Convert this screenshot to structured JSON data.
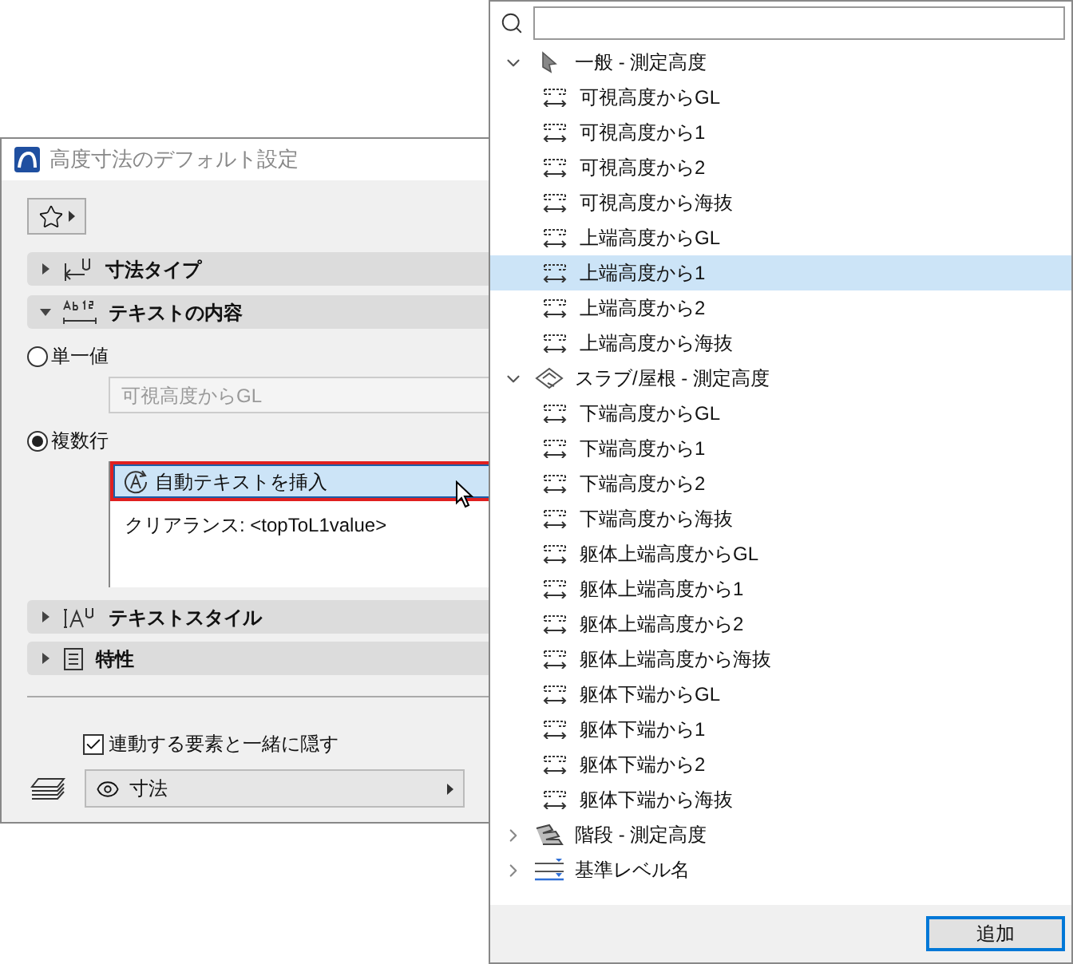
{
  "dialog": {
    "title": "高度寸法のデフォルト設定",
    "sections_top": [
      {
        "title": "寸法タイプ",
        "kind": "dimension",
        "expanded": false
      },
      {
        "title": "テキストの内容",
        "kind": "text",
        "expanded": true
      }
    ],
    "content_options": [
      {
        "label": "単一値",
        "selected": false,
        "field_value": "可視高度からGL"
      },
      {
        "label": "複数行",
        "selected": true,
        "insert_button": "自動テキストを挿入",
        "text": "クリアランス: <topToL1value>"
      }
    ],
    "sections_bottom": [
      {
        "title": "テキストスタイル",
        "kind": "style",
        "expanded": false
      },
      {
        "title": "特性",
        "kind": "properties",
        "expanded": false
      }
    ],
    "hide_checkbox": {
      "label": "連動する要素と一緒に隠す",
      "checked": true
    },
    "layer": {
      "value": "寸法"
    }
  },
  "popup": {
    "groups": [
      {
        "label": "一般 - 測定高度",
        "kind": "cursor",
        "expanded": true,
        "children": [
          {
            "label": "可視高度からGL",
            "selected": false
          },
          {
            "label": "可視高度から1",
            "selected": false
          },
          {
            "label": "可視高度から2",
            "selected": false
          },
          {
            "label": "可視高度から海抜",
            "selected": false
          },
          {
            "label": "上端高度からGL",
            "selected": false
          },
          {
            "label": "上端高度から1",
            "selected": true
          },
          {
            "label": "上端高度から2",
            "selected": false
          },
          {
            "label": "上端高度から海抜",
            "selected": false
          }
        ]
      },
      {
        "label": "スラブ/屋根 - 測定高度",
        "kind": "slab",
        "expanded": true,
        "children": [
          {
            "label": "下端高度からGL",
            "selected": false
          },
          {
            "label": "下端高度から1",
            "selected": false
          },
          {
            "label": "下端高度から2",
            "selected": false
          },
          {
            "label": "下端高度から海抜",
            "selected": false
          },
          {
            "label": "躯体上端高度からGL",
            "selected": false
          },
          {
            "label": "躯体上端高度から1",
            "selected": false
          },
          {
            "label": "躯体上端高度から2",
            "selected": false
          },
          {
            "label": "躯体上端高度から海抜",
            "selected": false
          },
          {
            "label": "躯体下端からGL",
            "selected": false
          },
          {
            "label": "躯体下端から1",
            "selected": false
          },
          {
            "label": "躯体下端から2",
            "selected": false
          },
          {
            "label": "躯体下端から海抜",
            "selected": false
          }
        ]
      },
      {
        "label": "階段 - 測定高度",
        "kind": "stair",
        "expanded": false
      },
      {
        "label": "基準レベル名",
        "kind": "level",
        "expanded": false
      }
    ],
    "add_button": "追加"
  }
}
